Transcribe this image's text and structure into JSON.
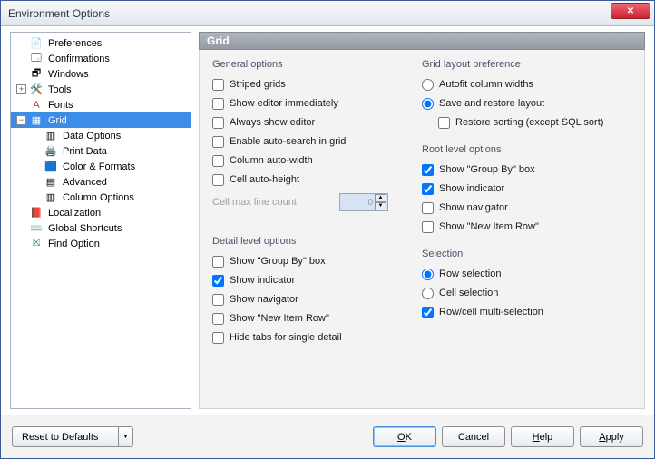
{
  "window": {
    "title": "Environment Options"
  },
  "tree": {
    "preferences": "Preferences",
    "confirmations": "Confirmations",
    "windows": "Windows",
    "tools": "Tools",
    "fonts": "Fonts",
    "grid": "Grid",
    "data_options": "Data Options",
    "print_data": "Print Data",
    "color_formats": "Color & Formats",
    "advanced": "Advanced",
    "column_options": "Column Options",
    "localization": "Localization",
    "global_shortcuts": "Global Shortcuts",
    "find_option": "Find Option"
  },
  "header": "Grid",
  "general": {
    "title": "General options",
    "striped": "Striped grids",
    "show_editor_imm": "Show editor immediately",
    "always_show_editor": "Always show editor",
    "auto_search": "Enable auto-search in grid",
    "col_auto_width": "Column auto-width",
    "cell_auto_height": "Cell auto-height",
    "max_line_label": "Cell max line count",
    "max_line_value": "0"
  },
  "detail": {
    "title": "Detail level options",
    "group_by": "Show \"Group By\" box",
    "indicator": "Show indicator",
    "navigator": "Show navigator",
    "new_item": "Show \"New Item Row\"",
    "hide_tabs": "Hide tabs for single detail"
  },
  "layout": {
    "title": "Grid layout preference",
    "autofit": "Autofit column widths",
    "save_restore": "Save and restore layout",
    "restore_sort": "Restore sorting (except SQL sort)"
  },
  "root": {
    "title": "Root level options",
    "group_by": "Show \"Group By\" box",
    "indicator": "Show indicator",
    "navigator": "Show navigator",
    "new_item": "Show \"New Item Row\""
  },
  "selection": {
    "title": "Selection",
    "row": "Row selection",
    "cell": "Cell selection",
    "multi": "Row/cell multi-selection"
  },
  "buttons": {
    "reset": "Reset to Defaults",
    "ok": "OK",
    "cancel": "Cancel",
    "help": "Help",
    "apply": "Apply"
  }
}
